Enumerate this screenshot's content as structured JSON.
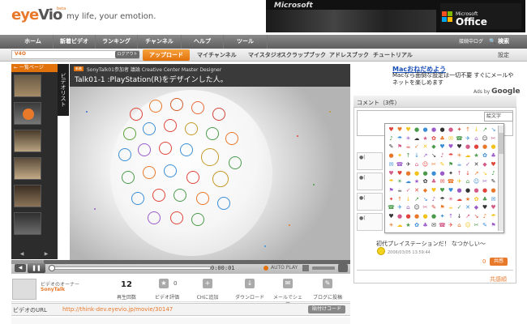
{
  "header": {
    "logo_text_1": "eye",
    "logo_text_2": "Vio",
    "logo_beta": "beta",
    "tagline": "my life, your emotion.",
    "ad": {
      "top_text": "Microsoft",
      "small_text": "Microsoft",
      "office_text": "Office"
    }
  },
  "nav": {
    "items": [
      "ホーム",
      "新着ビデオ",
      "ランキング",
      "チャンネル",
      "ヘルプ",
      "ツール"
    ],
    "login": "接続中",
    "settings": "ログ",
    "search": "🔍 検索"
  },
  "subnav": {
    "username": "V4O",
    "logout": "ログアウト",
    "upload": "アップロード",
    "items": [
      "マイチャンネル",
      "マイスタジオ",
      "スクラップブック",
      "アドレスブック",
      "チュートリアル"
    ],
    "settings": "設定"
  },
  "sidebar": {
    "header": "← 一覧ページ",
    "tab": "ビデオリスト",
    "prev": "◀",
    "next": "▶"
  },
  "player": {
    "badge": "新着",
    "series": "SonyTalk01参加者 議論 Creative Center Master Designer",
    "title": "Talk01-1 :PlayStation(R)をデザインした人。",
    "time": "0:00:01",
    "autoplay": "AUTO PLAY",
    "progress_fraction": 0.02
  },
  "stats": {
    "owner_label": "ビデオのオーナー",
    "owner_name": "SonyTalk",
    "views": "12",
    "views_label": "再生回数",
    "rating_num": "0",
    "rating_label": "ビデオ評価",
    "add_label": "CHに追加",
    "download_label": "ダウンロード",
    "mail_label": "メールでシェア",
    "blog_label": "ブログに投稿"
  },
  "url": {
    "label": "ビデオのURL",
    "value": "http://think-dev.eyevio.jp/movie/30147",
    "paste": "貼付けコード"
  },
  "right_ad": {
    "title": "Macおねだめよう",
    "body": "Macなら面倒な設定は一切不要 すぐにメールやネットを楽しめます",
    "ads_by": "Ads by",
    "google": "Google"
  },
  "comments": {
    "label": "コメント（3件）",
    "select": "絵文字",
    "text": "初代プレイステーションだ！ なつかしい〜",
    "time": "2006/03/05 13:59:44",
    "count": "0",
    "like": "共感",
    "share": "共感順"
  }
}
